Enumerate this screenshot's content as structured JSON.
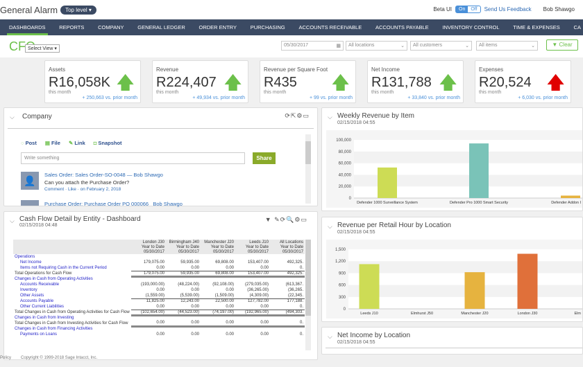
{
  "header": {
    "app_name": "General Alarm",
    "level": "Top level",
    "beta_label": "Beta UI",
    "beta_on": "On",
    "beta_off": "Off",
    "feedback": "Send Us Feedback",
    "user": "Bob Shawgo"
  },
  "nav": [
    "DASHBOARDS",
    "REPORTS",
    "COMPANY",
    "GENERAL LEDGER",
    "ORDER ENTRY",
    "PURCHASING",
    "ACCOUNTS RECEIVABLE",
    "ACCOUNTS PAYABLE",
    "INVENTORY CONTROL",
    "TIME & EXPENSES",
    "CA"
  ],
  "nav_active": "DASHBOARDS",
  "dashboard": {
    "title": "CFO",
    "select_view": "Select View",
    "date": "05/30/2017",
    "locations": "All locations",
    "customers": "All customers",
    "items": "All items",
    "clear": "Clear"
  },
  "kpis": [
    {
      "title": "Assets",
      "value": "R16,058K",
      "period": "this month",
      "change": "+ 250,663 vs. prior month",
      "trend": "up",
      "color": "#6cc04a"
    },
    {
      "title": "Revenue",
      "value": "R224,407",
      "period": "this month",
      "change": "+ 49,934 vs. prior month",
      "trend": "up",
      "color": "#6cc04a"
    },
    {
      "title": "Revenue per Square Foot",
      "value": "R435",
      "period": "this month",
      "change": "+ 99 vs. prior month",
      "trend": "up",
      "color": "#6cc04a"
    },
    {
      "title": "Net Income",
      "value": "R131,788",
      "period": "this month",
      "change": "+ 33,840 vs. prior month",
      "trend": "up",
      "color": "#6cc04a"
    },
    {
      "title": "Expenses",
      "value": "R20,524",
      "period": "this month",
      "change": "+ 6,030 vs. prior month",
      "trend": "up",
      "color": "#e00000"
    }
  ],
  "company": {
    "title": "Company",
    "tabs": [
      "Post",
      "File",
      "Link",
      "Snapshot"
    ],
    "placeholder": "Write something",
    "share": "Share",
    "feed": [
      {
        "title": "Sales Order: Sales Order-SO-0048",
        "author": "— Bob Shawgo",
        "body": "Can you attach the Purchase Order?",
        "meta": "Comment · Like · on February 2, 2018"
      },
      {
        "title": "Purchase Order: Purchase Order PO 000066",
        "author": "Bob Shawgo"
      }
    ]
  },
  "cashflow": {
    "title": "Cash Flow Detail by Entity - Dashboard",
    "date": "02/15/2018 04:48",
    "columns": [
      {
        "name": "London J30",
        "sub": "Year to Date",
        "date": "05/30/2017"
      },
      {
        "name": "Birmingham J40",
        "sub": "Year to Date",
        "date": "05/30/2017"
      },
      {
        "name": "Manchester J20",
        "sub": "Year to Date",
        "date": "05/30/2017"
      },
      {
        "name": "Leeds J10",
        "sub": "Year to Date",
        "date": "05/30/2017"
      },
      {
        "name": "All Locations",
        "sub": "Year to Date",
        "date": "05/30/2017"
      }
    ],
    "rows": [
      {
        "label": "Operations",
        "type": "section"
      },
      {
        "label": "Net Income",
        "type": "item",
        "values": [
          "179,075.00",
          "59,935.00",
          "69,808.00",
          "153,407.00",
          "492,325."
        ]
      },
      {
        "label": "Items not Requiring Cash in the Current Period",
        "type": "item",
        "line": "ul",
        "values": [
          "0.00",
          "0.00",
          "0.00",
          "0.00",
          "0."
        ]
      },
      {
        "label": "Total Operations for Cash Flow",
        "type": "total",
        "line": "tl",
        "values": [
          "179,075.00",
          "59,935.00",
          "69,808.00",
          "153,407.00",
          "492,325."
        ]
      },
      {
        "label": "Changes in Cash from Operating Activities",
        "type": "section"
      },
      {
        "label": "Accounts Receivable",
        "type": "item",
        "values": [
          "(193,000.00)",
          "(48,224.00)",
          "(92,108.00)",
          "(279,035.00)",
          "(613,367."
        ]
      },
      {
        "label": "Inventory",
        "type": "item",
        "values": [
          "0.00",
          "0.00",
          "0.00",
          "(36,265.00)",
          "(36,265."
        ]
      },
      {
        "label": "Other Assets",
        "type": "item",
        "line": "ul",
        "values": [
          "(1,559.00)",
          "(5,539.00)",
          "(1,509.00)",
          "(4,309.00)",
          "(22,345."
        ]
      },
      {
        "label": "Accounts Payable",
        "type": "item",
        "values": [
          "11,825.00",
          "12,243.00",
          "22,500.00",
          "127,782.00",
          "177,188."
        ]
      },
      {
        "label": "Other Current Liabilities",
        "type": "item",
        "line": "ul",
        "values": [
          "0.00",
          "0.00",
          "0.00",
          "0.00",
          "0."
        ]
      },
      {
        "label": "Total Changes in Cash from Operating Activities for Cash Flow",
        "type": "total",
        "line": "tl",
        "values": [
          "(102,654.00)",
          "(44,523.00)",
          "(74,197.00)",
          "(192,965.00)",
          "(494,303."
        ]
      },
      {
        "label": "Changes in Cash from Investing",
        "type": "section"
      },
      {
        "label": "Total Changes in Cash from Investing Activities for Cash Flow",
        "type": "total",
        "line": "tl",
        "values": [
          "0.00",
          "0.00",
          "0.00",
          "0.00",
          "0."
        ]
      },
      {
        "label": "Changes in Cash from Financing Activities",
        "type": "section"
      },
      {
        "label": "Payments on Loans",
        "type": "item",
        "values": [
          "0.00",
          "0.00",
          "0.00",
          "0.00",
          "0."
        ]
      }
    ]
  },
  "net_income": {
    "title": "Net Income by Location",
    "date": "02/15/2018 04:55"
  },
  "footer": {
    "policy": "Policy",
    "copyright": "Copyright © 1999-2018 Sage Intacct, Inc."
  },
  "chart_data": [
    {
      "type": "bar",
      "title": "Weekly Revenue by Item",
      "subtitle": "02/15/2018 04:55",
      "categories": [
        "Defender 1000 Surveillance System",
        "Defender Pro 1000 Smart Security",
        "Defender Addon I"
      ],
      "values": [
        52500,
        93900,
        4200
      ],
      "colors": [
        "#cddc55",
        "#7ac3b8",
        "#e6b33f"
      ],
      "ylim": [
        0,
        100000
      ],
      "yticks": [
        "0",
        "20,000",
        "40,000",
        "60,000",
        "80,000",
        "100,000"
      ],
      "grid": "banded"
    },
    {
      "type": "bar",
      "title": "Revenue per Retail Hour by Location",
      "subtitle": "02/15/2018 04:55",
      "categories": [
        "Leeds J10",
        "Elmhurst J50",
        "Manchester J20",
        "London J30",
        "Elm"
      ],
      "values": [
        1126,
        0,
        923,
        1387,
        0
      ],
      "colors": [
        "#cddc55",
        "#cddc55",
        "#e6b33f",
        "#e0703a",
        "#cddc55"
      ],
      "ylim": [
        0,
        1500
      ],
      "yticks": [
        "0",
        "300",
        "600",
        "900",
        "1,200",
        "1,500"
      ],
      "grid": "banded"
    }
  ]
}
